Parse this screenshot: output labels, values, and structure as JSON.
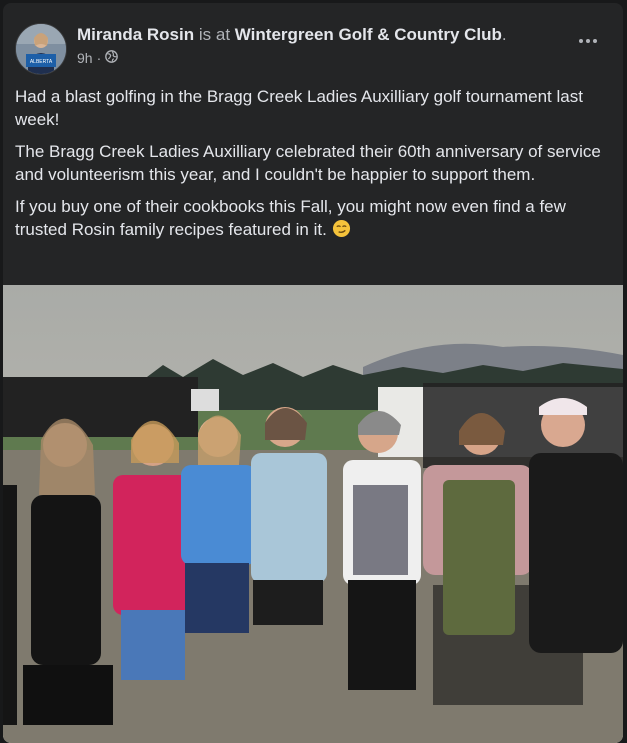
{
  "post": {
    "author": "Miranda Rosin",
    "connector": "is at",
    "location": "Wintergreen Golf & Country Club",
    "location_suffix": ".",
    "time": "9h",
    "time_sep": "·",
    "paragraphs": [
      "Had a blast golfing in the Bragg Creek Ladies Auxilliary golf tournament last week!",
      "The Bragg Creek Ladies Auxilliary celebrated their 60th anniversary of service and volunteerism this year, and I couldn't be happier to support them.",
      "If you buy one of their cookbooks this Fall, you might now even find a few trusted Rosin family  recipes featured in it."
    ],
    "emoji": "smirk-emoji",
    "privacy_icon": "globe-icon",
    "menu_icon": "more-options-icon",
    "avatar_text": "ALBERTA"
  },
  "photo": {
    "subject": "group-photo"
  },
  "colors": {
    "card": "#242526",
    "text": "#e4e6eb",
    "secondary": "#b0b3b8"
  }
}
